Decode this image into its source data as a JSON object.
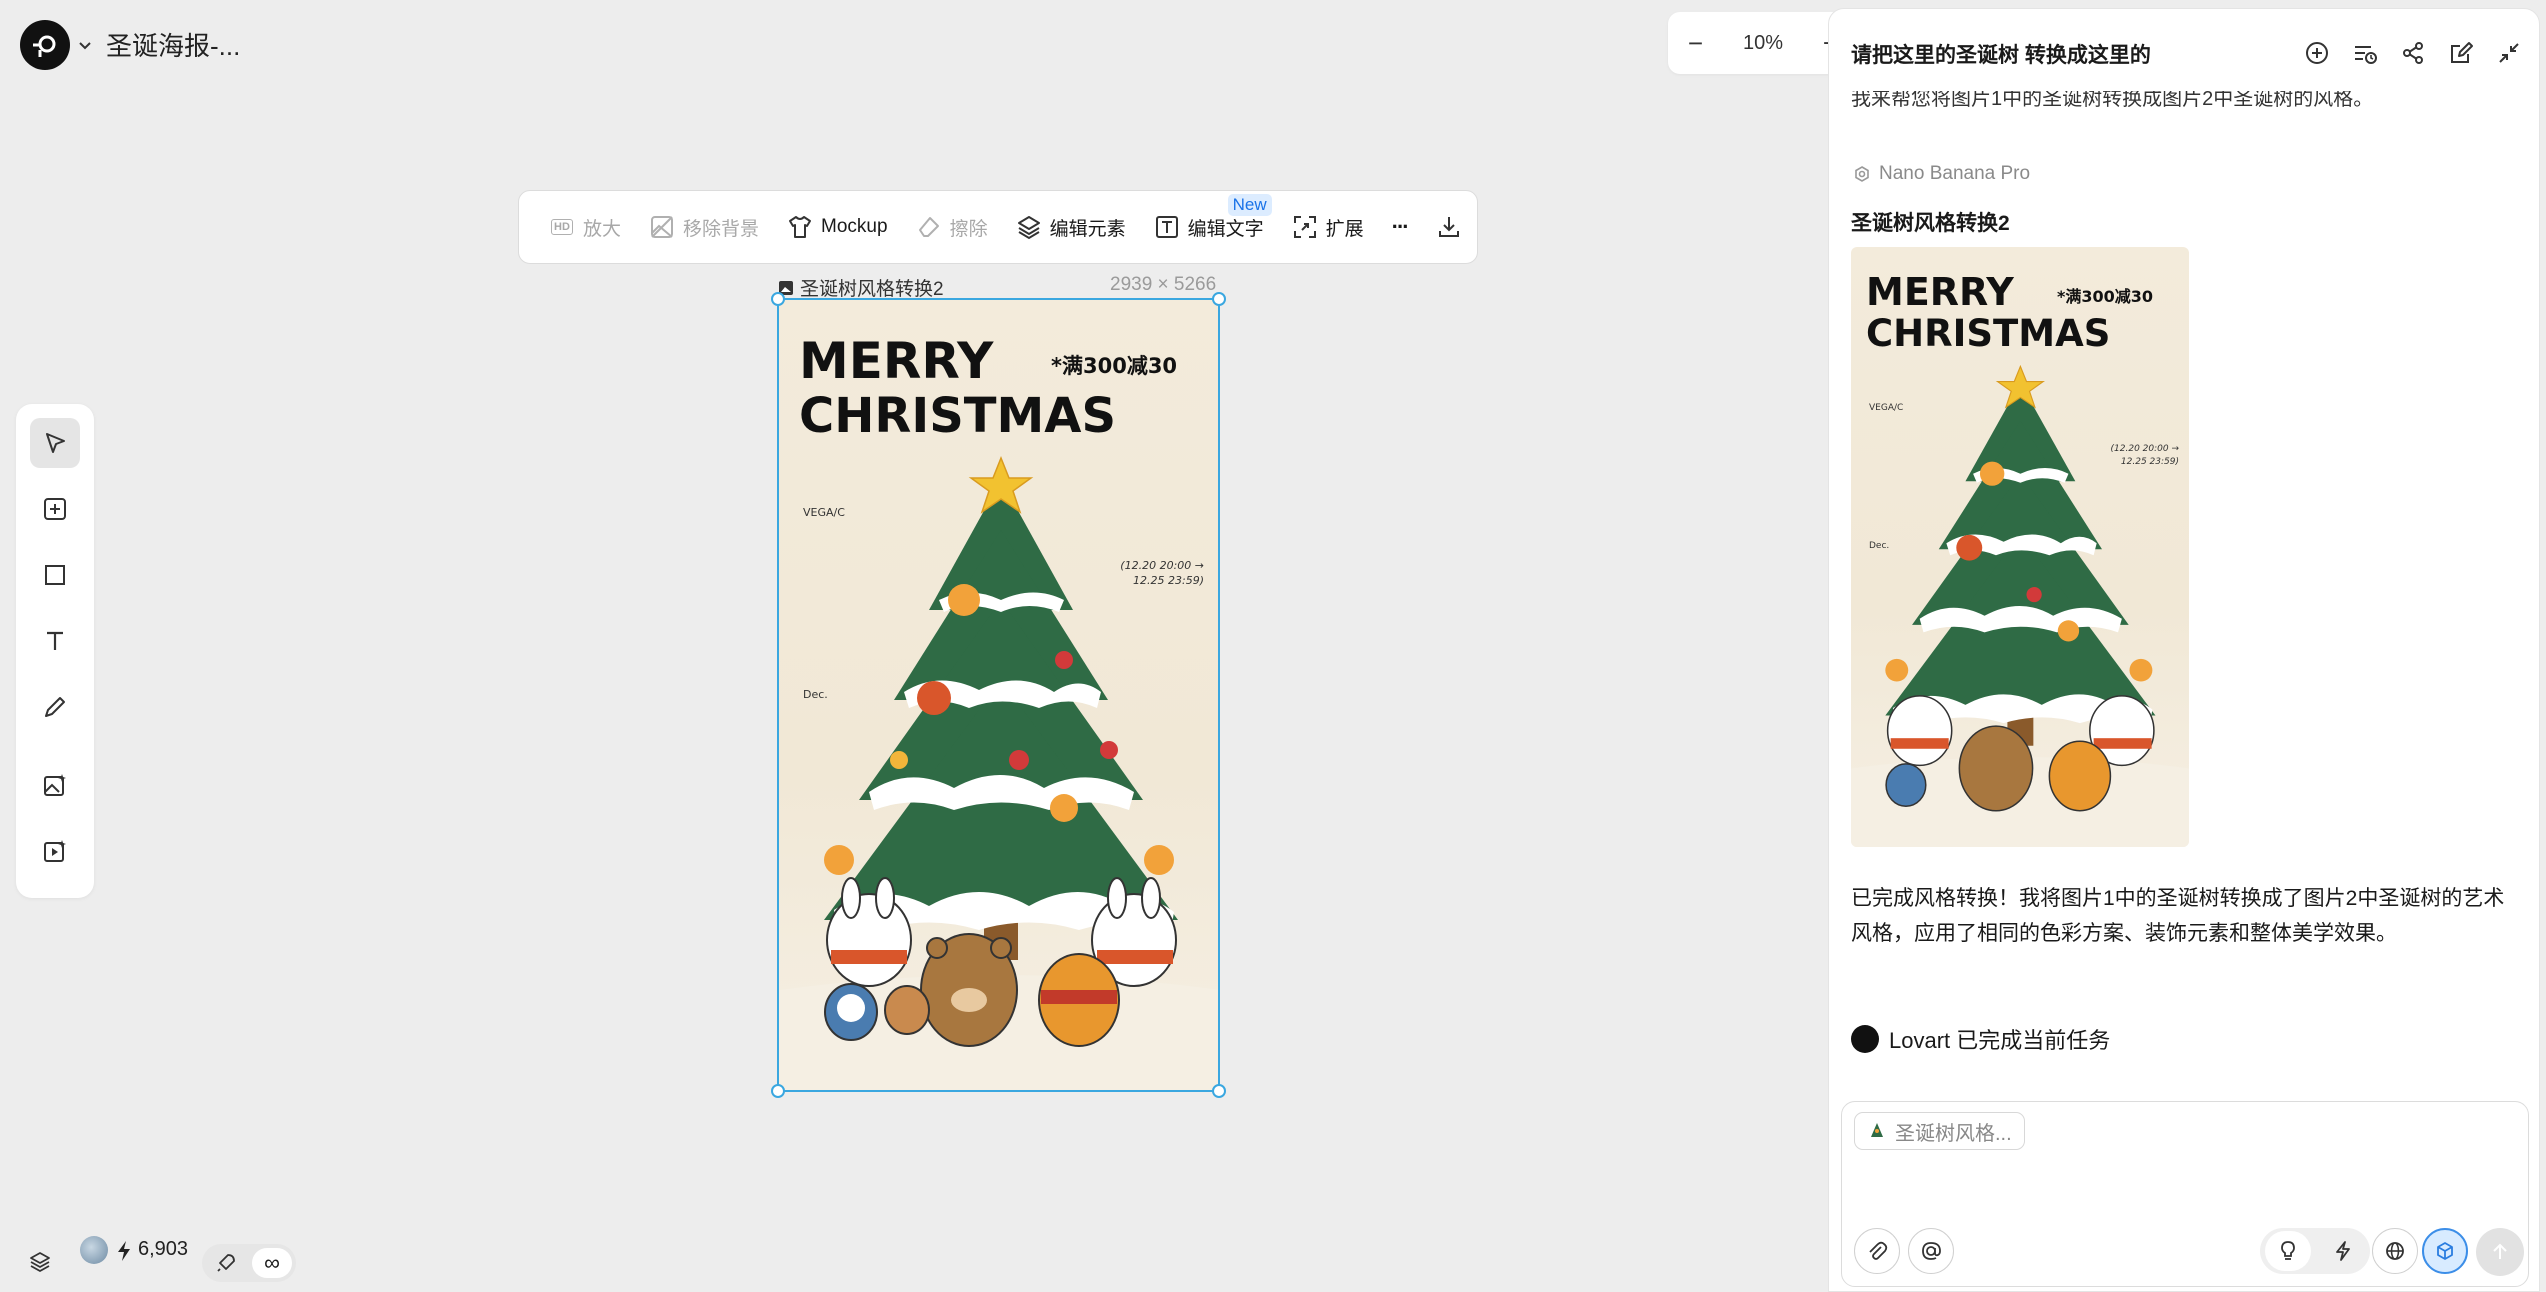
{
  "app": {
    "project_title": "圣诞海报-...",
    "zoom_level": "10%",
    "credits": "6,903",
    "infinity_label": "∞"
  },
  "toolbar": {
    "upscale_label": "放大",
    "upscale_badge": "HD",
    "remove_bg_label": "移除背景",
    "mockup_label": "Mockup",
    "erase_label": "擦除",
    "edit_elements_label": "编辑元素",
    "edit_text_label": "编辑文字",
    "new_badge": "New",
    "expand_label": "扩展",
    "more_label": "···"
  },
  "canvas": {
    "image_name": "圣诞树风格转换2",
    "image_size": "2939 × 5266"
  },
  "poster": {
    "line1": "MERRY",
    "line2": "CHRISTMAS",
    "promo": "*满300减30",
    "brand": "VEGA/C",
    "month": "Dec.",
    "date_range_1": "(12.20 20:00 →",
    "date_range_2": "12.25 23:59)"
  },
  "panel": {
    "title": "请把这里的圣诞树 转换成这里的",
    "cut_text": "我来帮您将图片1中的圣诞树转换成图片2中圣诞树的风格。",
    "model_name": "Nano Banana Pro",
    "result_name": "圣诞树风格转换2",
    "response_text": "已完成风格转换！我将图片1中的圣诞树转换成了图片2中圣诞树的艺术风格，应用了相同的色彩方案、装饰元素和整体美学效果。",
    "status_text": "Lovart 已完成当前任务",
    "input_chip": "圣诞树风格..."
  },
  "colors": {
    "accent": "#3aa7e0",
    "new_badge_text": "#1a73e8",
    "tree_green": "#2f6b45",
    "canvas_bg": "#ededed"
  }
}
